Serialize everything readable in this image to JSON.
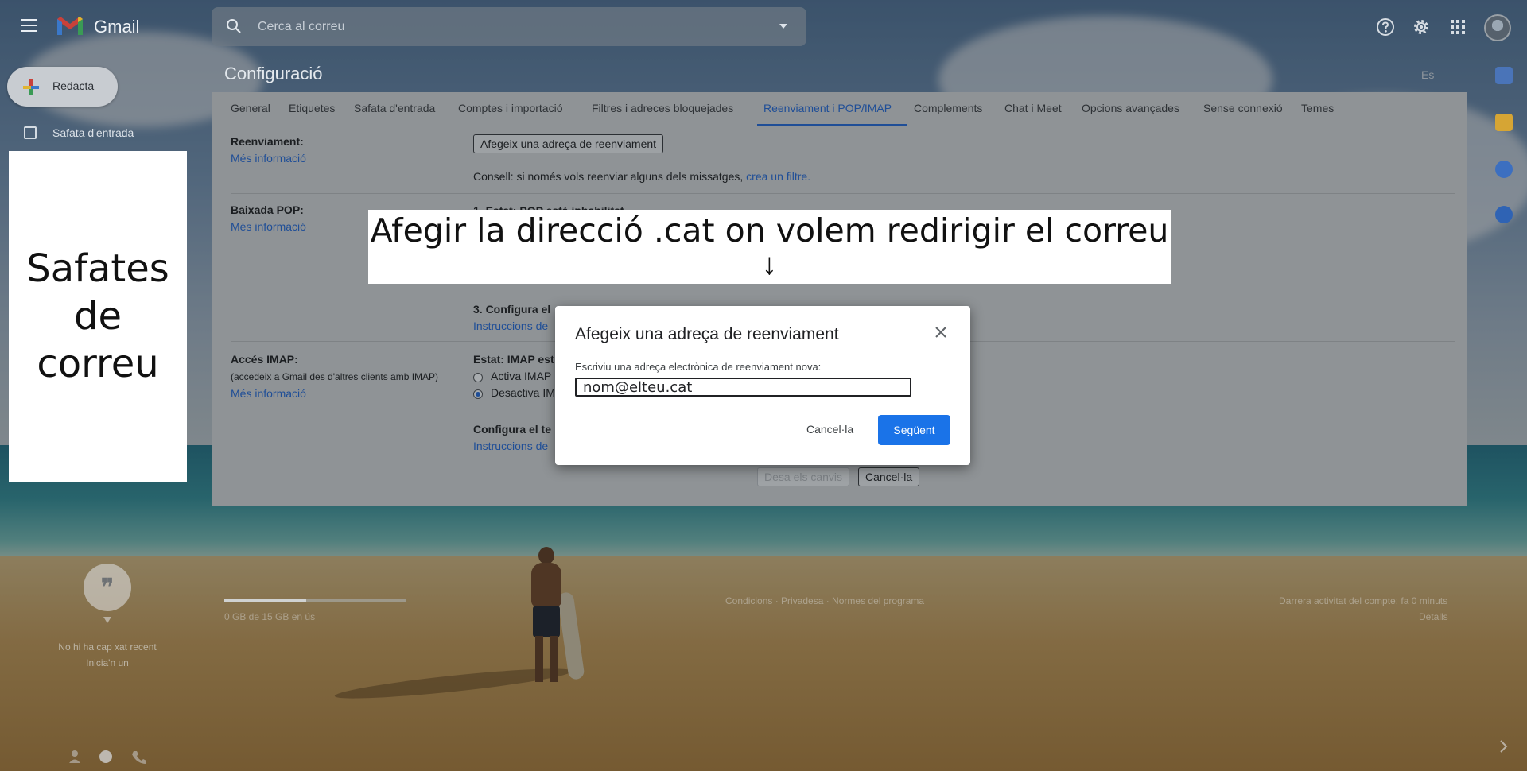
{
  "topbar": {
    "brand": "Gmail",
    "search_placeholder": "Cerca al correu"
  },
  "nav": {
    "compose_label": "Redacta",
    "inbox_label": "Safata d'entrada"
  },
  "callouts": {
    "left_line1": "Safates",
    "left_line2": "de correu",
    "top_text": "Afegir la direcció .cat on volem redirigir el correu",
    "top_arrow": "↓"
  },
  "settings": {
    "title": "Configuració",
    "language": "Es",
    "tabs": [
      {
        "label": "General"
      },
      {
        "label": "Etiquetes"
      },
      {
        "label": "Safata d'entrada"
      },
      {
        "label": "Comptes i importació"
      },
      {
        "label": "Filtres i adreces bloquejades"
      },
      {
        "label": "Reenviament i POP/IMAP"
      },
      {
        "label": "Complements"
      },
      {
        "label": "Chat i Meet"
      },
      {
        "label": "Opcions avançades"
      },
      {
        "label": "Sense connexió"
      },
      {
        "label": "Temes"
      }
    ],
    "active_tab": "Reenviament i POP/IMAP",
    "forwarding": {
      "label": "Reenviament:",
      "more_info": "Més informació",
      "add_button": "Afegeix una adreça de reenviament",
      "tip_text": "Consell: si només vols reenviar alguns dels missatges,",
      "tip_link": "crea un filtre."
    },
    "pop": {
      "label": "Baixada POP:",
      "more_info": "Més informació",
      "step1": "1. Estat: POP està inhabilitat",
      "step3": "3. Configura el",
      "instructions": "Instruccions de"
    },
    "imap": {
      "label": "Accés IMAP:",
      "sub": "(accedeix a Gmail des d'altres clients amb IMAP)",
      "more_info": "Més informació",
      "status": "Estat: IMAP est",
      "enable": "Activa IMAP",
      "disable": "Desactiva IM",
      "configure": "Configura el te",
      "instructions": "Instruccions de"
    },
    "save_button": "Desa els canvis",
    "cancel_button": "Cancel·la"
  },
  "dialog": {
    "title": "Afegeix una adreça de reenviament",
    "field_label": "Escriviu una adreça electrònica de reenviament nova:",
    "field_value": "nom@elteu.cat",
    "cancel_label": "Cancel·la",
    "next_label": "Següent"
  },
  "chat": {
    "empty_line1": "No hi ha cap xat recent",
    "empty_line2": "Inicia'n un"
  },
  "footer": {
    "storage": "0 GB de 15 GB en ús",
    "storage_fraction": 0.45,
    "center_links": "Condicions · Privadesa · Normes del programa",
    "right_line1": "Darrera activitat del compte: fa 0 minuts",
    "right_line2": "Detalls"
  },
  "colors": {
    "accent": "#1a73e8",
    "active_tab": "#1f4e97"
  }
}
